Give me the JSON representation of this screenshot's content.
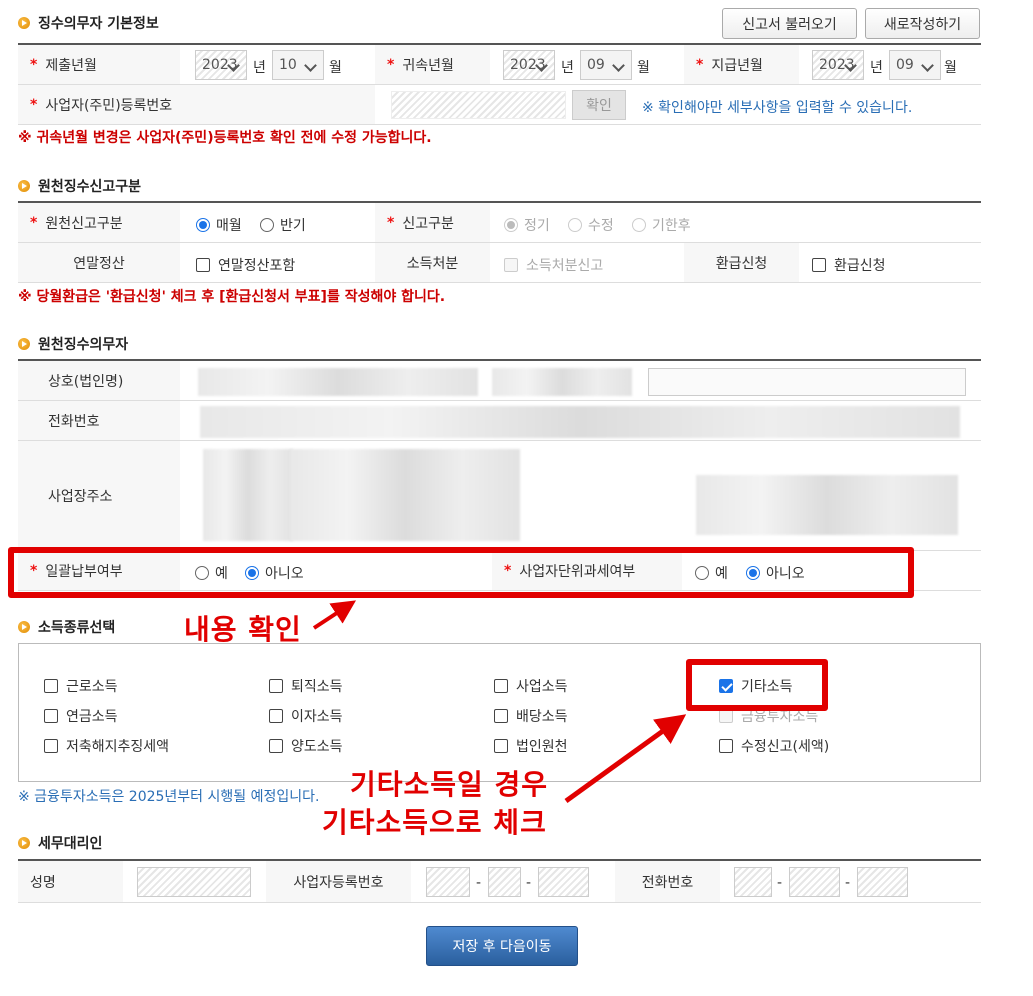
{
  "header": {
    "section1_title": "징수의무자 기본정보",
    "load_button": "신고서 불러오기",
    "new_button": "새로작성하기"
  },
  "basic": {
    "submit_label": "제출년월",
    "submit_year": "2023",
    "submit_month": "10",
    "belong_label": "귀속년월",
    "belong_year": "2023",
    "belong_month": "09",
    "pay_label": "지급년월",
    "pay_year": "2023",
    "pay_month": "09",
    "year_unit": "년",
    "month_unit": "월",
    "biz_reg_label": "사업자(주민)등록번호",
    "confirm_button": "확인",
    "confirm_note": "※ 확인해야만 세부사항을 입력할 수 있습니다.",
    "warn_note": "※ 귀속년월 변경은 사업자(주민)등록번호 확인 전에 수정 가능합니다."
  },
  "report_type": {
    "title": "원천징수신고구분",
    "type_label": "원천신고구분",
    "monthly": "매월",
    "half": "반기",
    "report_label": "신고구분",
    "regular": "정기",
    "amend": "수정",
    "late": "기한후",
    "year_end_label": "연말정산",
    "year_end_option": "연말정산포함",
    "income_disp_label": "소득처분",
    "income_disp_option": "소득처분신고",
    "refund_label": "환급신청",
    "refund_option": "환급신청",
    "refund_note": "※ 당월환급은 '환급신청' 체크 후 [환급신청서 부표]를 작성해야 합니다."
  },
  "obligor": {
    "title": "원천징수의무자",
    "company_label": "상호(법인명)",
    "phone_label": "전화번호",
    "address_label": "사업장주소",
    "lump_label": "일괄납부여부",
    "yes": "예",
    "no": "아니오",
    "unit_tax_label": "사업자단위과세여부"
  },
  "income_types": {
    "title": "소득종류선택",
    "items": [
      {
        "label": "근로소득",
        "checked": false,
        "disabled": false
      },
      {
        "label": "퇴직소득",
        "checked": false,
        "disabled": false
      },
      {
        "label": "사업소득",
        "checked": false,
        "disabled": false
      },
      {
        "label": "기타소득",
        "checked": true,
        "disabled": false
      },
      {
        "label": "연금소득",
        "checked": false,
        "disabled": false
      },
      {
        "label": "이자소득",
        "checked": false,
        "disabled": false
      },
      {
        "label": "배당소득",
        "checked": false,
        "disabled": false
      },
      {
        "label": "금융투자소득",
        "checked": false,
        "disabled": true
      },
      {
        "label": "저축해지추징세액",
        "checked": false,
        "disabled": false
      },
      {
        "label": "양도소득",
        "checked": false,
        "disabled": false
      },
      {
        "label": "법인원천",
        "checked": false,
        "disabled": false
      },
      {
        "label": "수정신고(세액)",
        "checked": false,
        "disabled": false
      }
    ],
    "note": "※ 금융투자소득은 2025년부터 시행될 예정입니다."
  },
  "agent": {
    "title": "세무대리인",
    "name_label": "성명",
    "biz_label": "사업자등록번호",
    "phone_label": "전화번호",
    "dash": "-"
  },
  "annotations": {
    "check_content": "내용 확인",
    "other_line1": "기타소득일 경우",
    "other_line2": "기타소득으로 체크"
  },
  "save_button": "저장 후 다음이동",
  "colors": {
    "accent": "#1a73e8",
    "warn": "#cc0000",
    "annotation": "#e10000",
    "save": "#2a5f9e"
  }
}
